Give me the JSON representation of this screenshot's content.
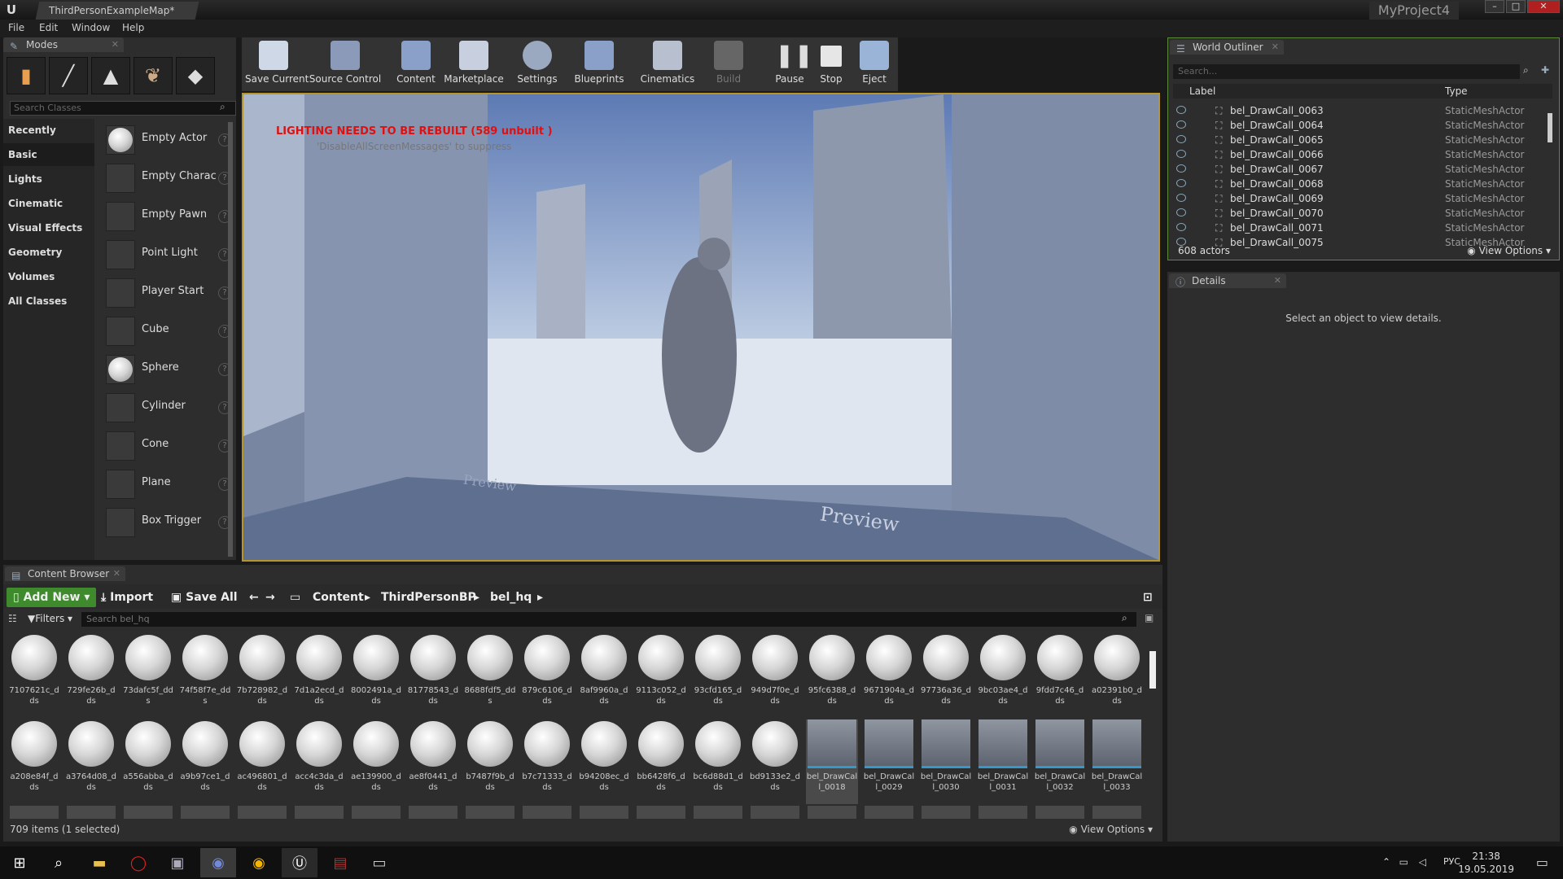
{
  "titlebar": {
    "doc_tab": "ThirdPersonExampleMap*",
    "project": "MyProject4",
    "logo": "U"
  },
  "menu": [
    "File",
    "Edit",
    "Window",
    "Help"
  ],
  "modes": {
    "tab": "Modes",
    "search_placeholder": "Search Classes",
    "categories": [
      "Recently Placed",
      "Basic",
      "Lights",
      "Cinematic",
      "Visual Effects",
      "Geometry",
      "Volumes",
      "All Classes"
    ],
    "actors": [
      "Empty Actor",
      "Empty Charac",
      "Empty Pawn",
      "Point Light",
      "Player Start",
      "Cube",
      "Sphere",
      "Cylinder",
      "Cone",
      "Plane",
      "Box Trigger"
    ]
  },
  "toolbar": [
    "Save Current",
    "Source Control",
    "Content",
    "Marketplace",
    "Settings",
    "Blueprints",
    "Cinematics",
    "Build",
    "Pause",
    "Stop",
    "Eject"
  ],
  "viewport": {
    "warning": "LIGHTING NEEDS TO BE REBUILT (589 unbuilt )",
    "sub": "'DisableAllScreenMessages' to suppress",
    "preview": "Preview"
  },
  "outliner": {
    "tab": "World Outliner",
    "search_placeholder": "Search...",
    "col_label": "Label",
    "col_type": "Type",
    "rows": [
      {
        "label": "bel_DrawCall_0063",
        "type": "StaticMeshActor"
      },
      {
        "label": "bel_DrawCall_0064",
        "type": "StaticMeshActor"
      },
      {
        "label": "bel_DrawCall_0065",
        "type": "StaticMeshActor"
      },
      {
        "label": "bel_DrawCall_0066",
        "type": "StaticMeshActor"
      },
      {
        "label": "bel_DrawCall_0067",
        "type": "StaticMeshActor"
      },
      {
        "label": "bel_DrawCall_0068",
        "type": "StaticMeshActor"
      },
      {
        "label": "bel_DrawCall_0069",
        "type": "StaticMeshActor"
      },
      {
        "label": "bel_DrawCall_0070",
        "type": "StaticMeshActor"
      },
      {
        "label": "bel_DrawCall_0071",
        "type": "StaticMeshActor"
      },
      {
        "label": "bel_DrawCall_0075",
        "type": "StaticMeshActor"
      }
    ],
    "count": "608 actors",
    "view_options": "View Options"
  },
  "details": {
    "tab": "Details",
    "message": "Select an object to view details."
  },
  "content_browser": {
    "tab": "Content Browser",
    "add_new": "Add New",
    "import": "Import",
    "save_all": "Save All",
    "crumbs": [
      "Content",
      "ThirdPersonBP",
      "bel_hq"
    ],
    "filters": "Filters",
    "search_placeholder": "Search bel_hq",
    "row1": [
      "7107621c_dds",
      "729fe26b_dds",
      "73dafc5f_dds",
      "74f58f7e_dds",
      "7b728982_dds",
      "7d1a2ecd_dds",
      "8002491a_dds",
      "81778543_dds",
      "8688fdf5_dds",
      "879c6106_dds",
      "8af9960a_dds",
      "9113c052_dds",
      "93cfd165_dds",
      "949d7f0e_dds",
      "95fc6388_dds",
      "9671904a_dds",
      "97736a36_dds",
      "9bc03ae4_dds",
      "9fdd7c46_dds",
      "a02391b0_dds"
    ],
    "row2": [
      "a208e84f_dds",
      "a3764d08_dds",
      "a556abba_dds",
      "a9b97ce1_dds",
      "ac496801_dds",
      "acc4c3da_dds",
      "ae139900_dds",
      "ae8f0441_dds",
      "b7487f9b_dds",
      "b7c71333_dds",
      "b94208ec_dds",
      "bb6428f6_dds",
      "bc6d88d1_dds",
      "bd9133e2_dds",
      "bel_DrawCall_0018",
      "bel_DrawCall_0029",
      "bel_DrawCall_0030",
      "bel_DrawCall_0031",
      "bel_DrawCall_0032",
      "bel_DrawCall_0033"
    ],
    "status": "709 items (1 selected)",
    "view_options": "View Options"
  },
  "taskbar": {
    "lang": "РУС",
    "time": "21:38",
    "date": "19.05.2019"
  }
}
